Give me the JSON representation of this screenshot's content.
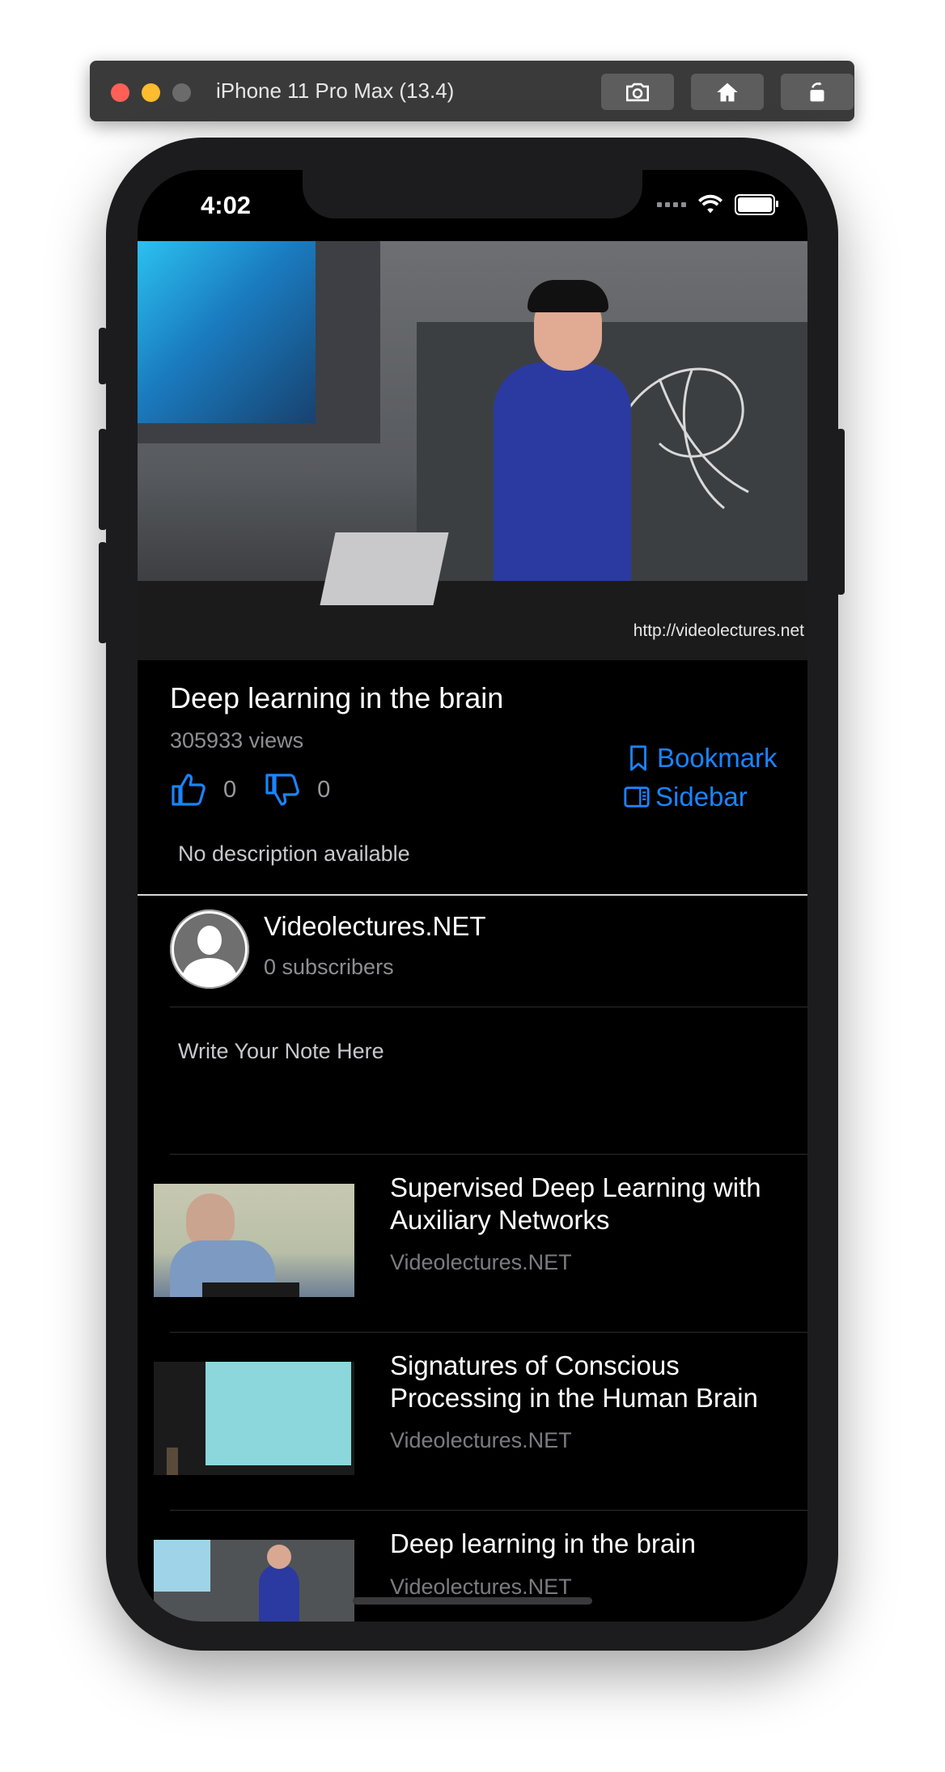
{
  "simulator": {
    "title": "iPhone 11 Pro Max (13.4)",
    "buttons": [
      "screenshot-icon",
      "home-icon",
      "rotate-icon"
    ]
  },
  "status_bar": {
    "time": "4:02"
  },
  "video": {
    "watermark": "http://videolectures.net"
  },
  "info": {
    "title": "Deep learning in the brain",
    "views": "305933 views",
    "likes": "0",
    "dislikes": "0",
    "bookmark_label": "Bookmark",
    "sidebar_label": "Sidebar",
    "description": "No description available"
  },
  "channel": {
    "name": "Videolectures.NET",
    "subscribers": "0 subscribers"
  },
  "note": {
    "placeholder": "Write Your Note Here"
  },
  "related": [
    {
      "title": "Supervised Deep Learning with Auxiliary Networks",
      "channel": "Videolectures.NET"
    },
    {
      "title": "Signatures of Conscious Processing in the Human Brain",
      "channel": "Videolectures.NET"
    },
    {
      "title": "Deep learning in the brain",
      "channel": "Videolectures.NET"
    }
  ],
  "colors": {
    "accent": "#1a84ff",
    "background": "#000000",
    "secondary_text": "#8e8e93"
  }
}
